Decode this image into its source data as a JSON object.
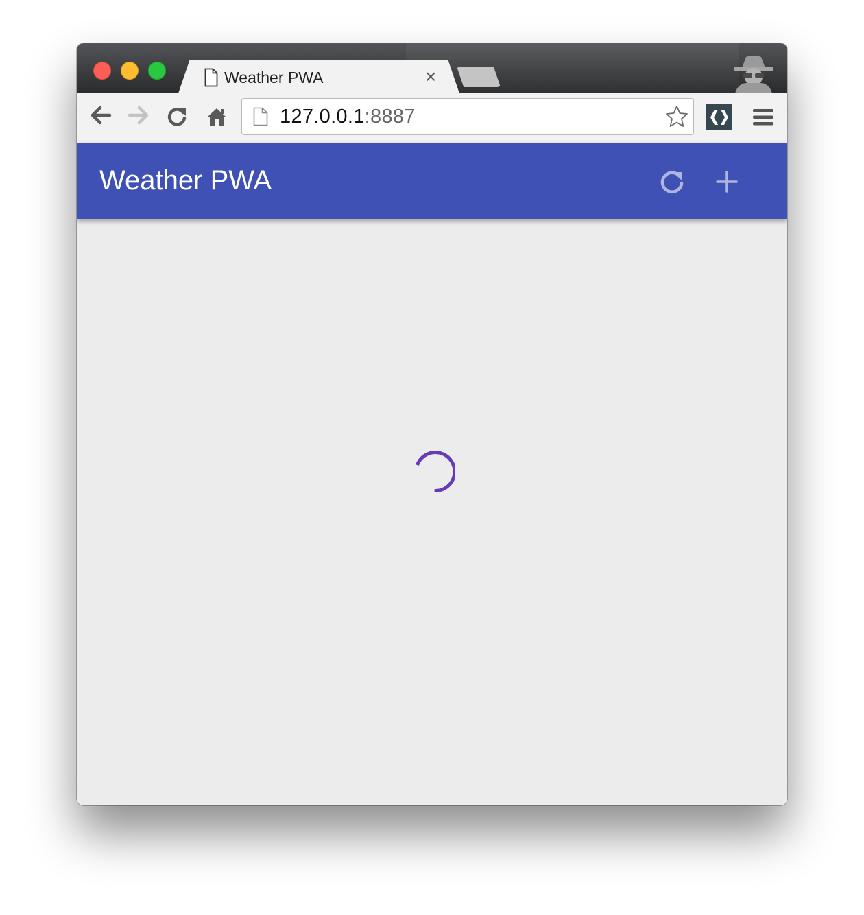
{
  "browser": {
    "tab": {
      "title": "Weather PWA",
      "close_glyph": "×",
      "icon": "page-icon"
    },
    "omnibox": {
      "host": "127.0.0.1",
      "port": ":8887",
      "page_icon": "page-icon",
      "bookmark_icon": "star-icon"
    },
    "toolbar": {
      "icons": [
        "back-arrow-icon",
        "forward-arrow-icon",
        "reload-icon",
        "home-icon",
        "extension-icon",
        "menu-icon"
      ]
    },
    "incognito_icon": "incognito-icon"
  },
  "app": {
    "title": "Weather PWA",
    "header_color": "#3f51b5",
    "actions": [
      "refresh-icon",
      "add-icon"
    ],
    "content_background": "#ececec",
    "loading": {
      "state": "loading",
      "spinner_color": "#673ab7"
    }
  }
}
